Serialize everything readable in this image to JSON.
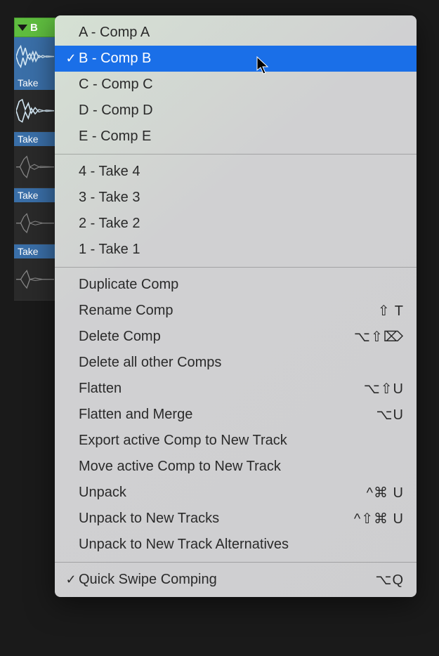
{
  "track": {
    "header": "B"
  },
  "takes": [
    "Take",
    "Take",
    "Take",
    "Take"
  ],
  "menu": {
    "comps": [
      {
        "label": "A - Comp A",
        "checked": false
      },
      {
        "label": "B - Comp B",
        "checked": true,
        "selected": true
      },
      {
        "label": "C - Comp C",
        "checked": false
      },
      {
        "label": "D - Comp D",
        "checked": false
      },
      {
        "label": "E - Comp E",
        "checked": false
      }
    ],
    "takesList": [
      {
        "label": "4 - Take 4"
      },
      {
        "label": "3 - Take 3"
      },
      {
        "label": "2 - Take 2"
      },
      {
        "label": "1 - Take 1"
      }
    ],
    "actions": [
      {
        "label": "Duplicate Comp",
        "shortcut": ""
      },
      {
        "label": "Rename Comp",
        "shortcut": "⇧ T"
      },
      {
        "label": "Delete Comp",
        "shortcut": "⌥⇧⌦"
      },
      {
        "label": "Delete all other Comps",
        "shortcut": ""
      },
      {
        "label": "Flatten",
        "shortcut": "⌥⇧U"
      },
      {
        "label": "Flatten and Merge",
        "shortcut": "⌥U"
      },
      {
        "label": "Export active Comp to New Track",
        "shortcut": ""
      },
      {
        "label": "Move active Comp to New Track",
        "shortcut": ""
      },
      {
        "label": "Unpack",
        "shortcut": "^⌘ U"
      },
      {
        "label": "Unpack to New Tracks",
        "shortcut": "^⇧⌘ U"
      },
      {
        "label": "Unpack to New Track Alternatives",
        "shortcut": ""
      }
    ],
    "footer": {
      "label": "Quick Swipe Comping",
      "shortcut": "⌥Q",
      "checked": true
    }
  }
}
